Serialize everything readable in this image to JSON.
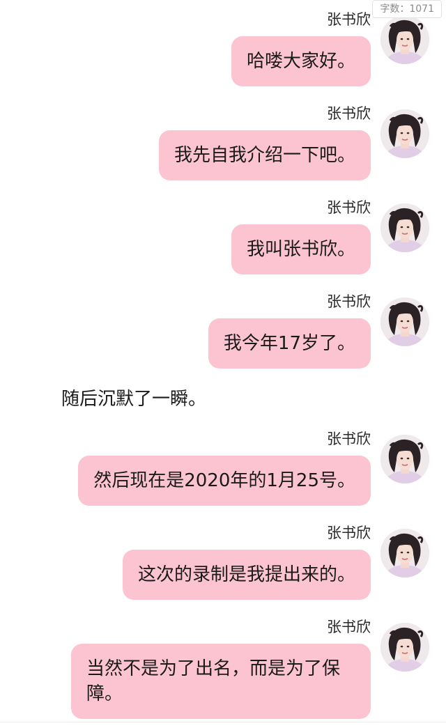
{
  "word_count": {
    "label": "字数：",
    "value": "1071"
  },
  "messages": [
    {
      "type": "bubble",
      "sender": "张书欣",
      "text": "哈喽大家好。"
    },
    {
      "type": "bubble",
      "sender": "张书欣",
      "text": "我先自我介绍一下吧。"
    },
    {
      "type": "bubble",
      "sender": "张书欣",
      "text": "我叫张书欣。"
    },
    {
      "type": "bubble",
      "sender": "张书欣",
      "text": "我今年17岁了。"
    },
    {
      "type": "narration",
      "text": "随后沉默了一瞬。"
    },
    {
      "type": "bubble",
      "sender": "张书欣",
      "text": "然后现在是2020年的1月25号。"
    },
    {
      "type": "bubble",
      "sender": "张书欣",
      "text": "这次的录制是我提出来的。"
    },
    {
      "type": "bubble",
      "sender": "张书欣",
      "text": "当然不是为了出名，而是为了保障。"
    }
  ],
  "colors": {
    "bubble": "#fcc4d1",
    "background": "#ffffff"
  },
  "icons": {
    "avatar": "profile-photo"
  }
}
